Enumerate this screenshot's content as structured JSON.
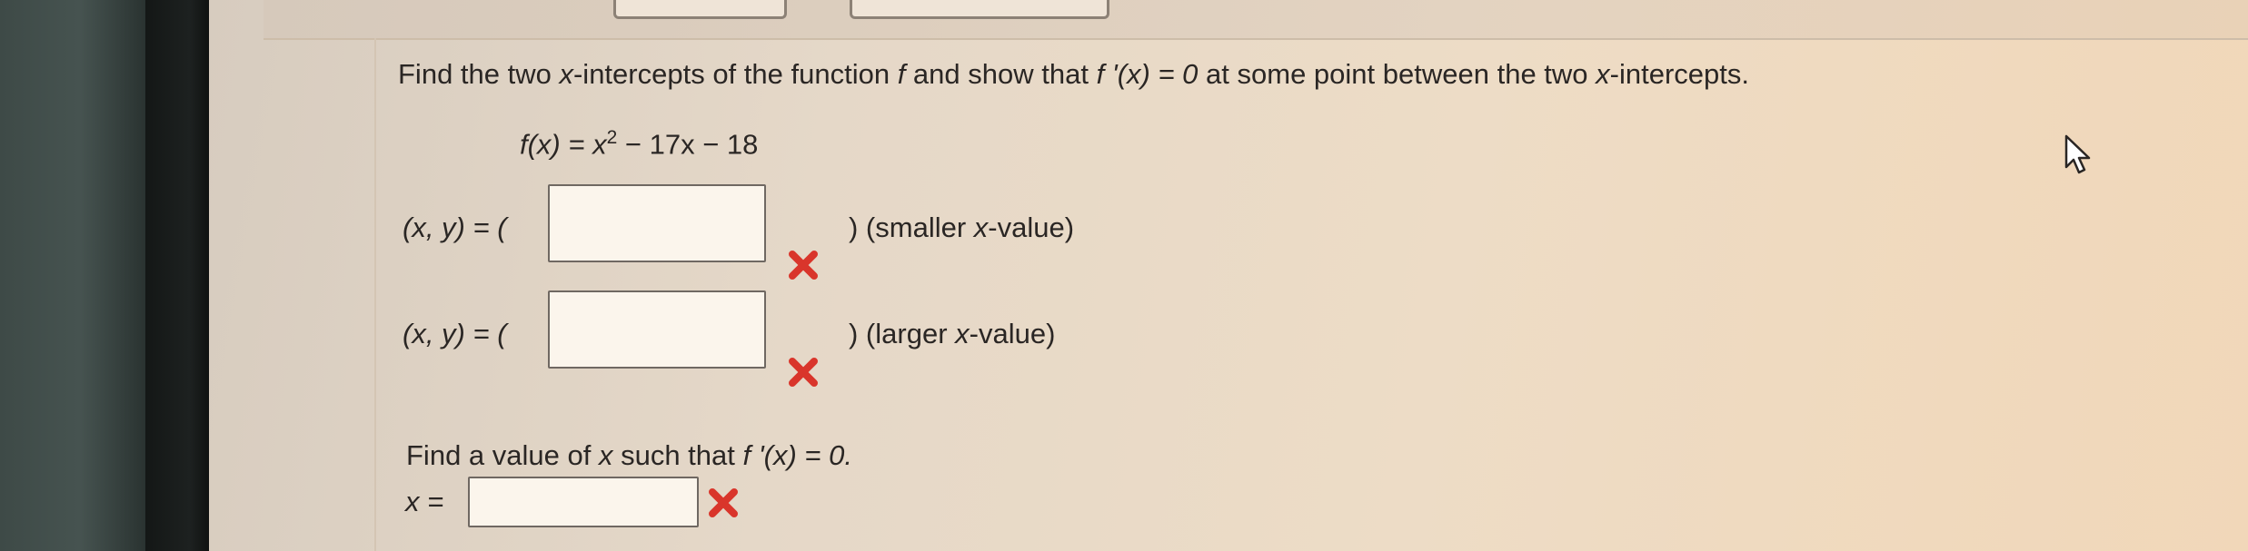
{
  "question": {
    "prompt_pre": "Find the two ",
    "prompt_x": "x",
    "prompt_mid": "-intercepts of the function ",
    "prompt_f": "f",
    "prompt_post": " and show that ",
    "prompt_fprime": "f '(x) = 0",
    "prompt_tail": " at some point between the two ",
    "prompt_x2": "x",
    "prompt_end": "-intercepts.",
    "function_lhs": "f(x) = x",
    "function_exp": "2",
    "function_rhs": " − 17x − 18"
  },
  "intercepts": [
    {
      "label": "(x, y) = (",
      "value": "",
      "suffix_pre": ") (smaller ",
      "suffix_x": "x",
      "suffix_post": "-value)",
      "status": "incorrect"
    },
    {
      "label": "(x, y) = (",
      "value": "",
      "suffix_pre": ") (larger ",
      "suffix_x": "x",
      "suffix_post": "-value)",
      "status": "incorrect"
    }
  ],
  "part2": {
    "prompt_pre": "Find a value of ",
    "prompt_x": "x",
    "prompt_mid": " such that ",
    "prompt_f": "f '(x) = 0.",
    "answer_label": "x =",
    "answer_value": "",
    "status": "incorrect"
  },
  "colors": {
    "incorrect_mark": "#d9352b",
    "text": "#2a2624"
  },
  "icons": {
    "incorrect": "x-mark-icon",
    "cursor": "pointer-cursor-icon"
  }
}
